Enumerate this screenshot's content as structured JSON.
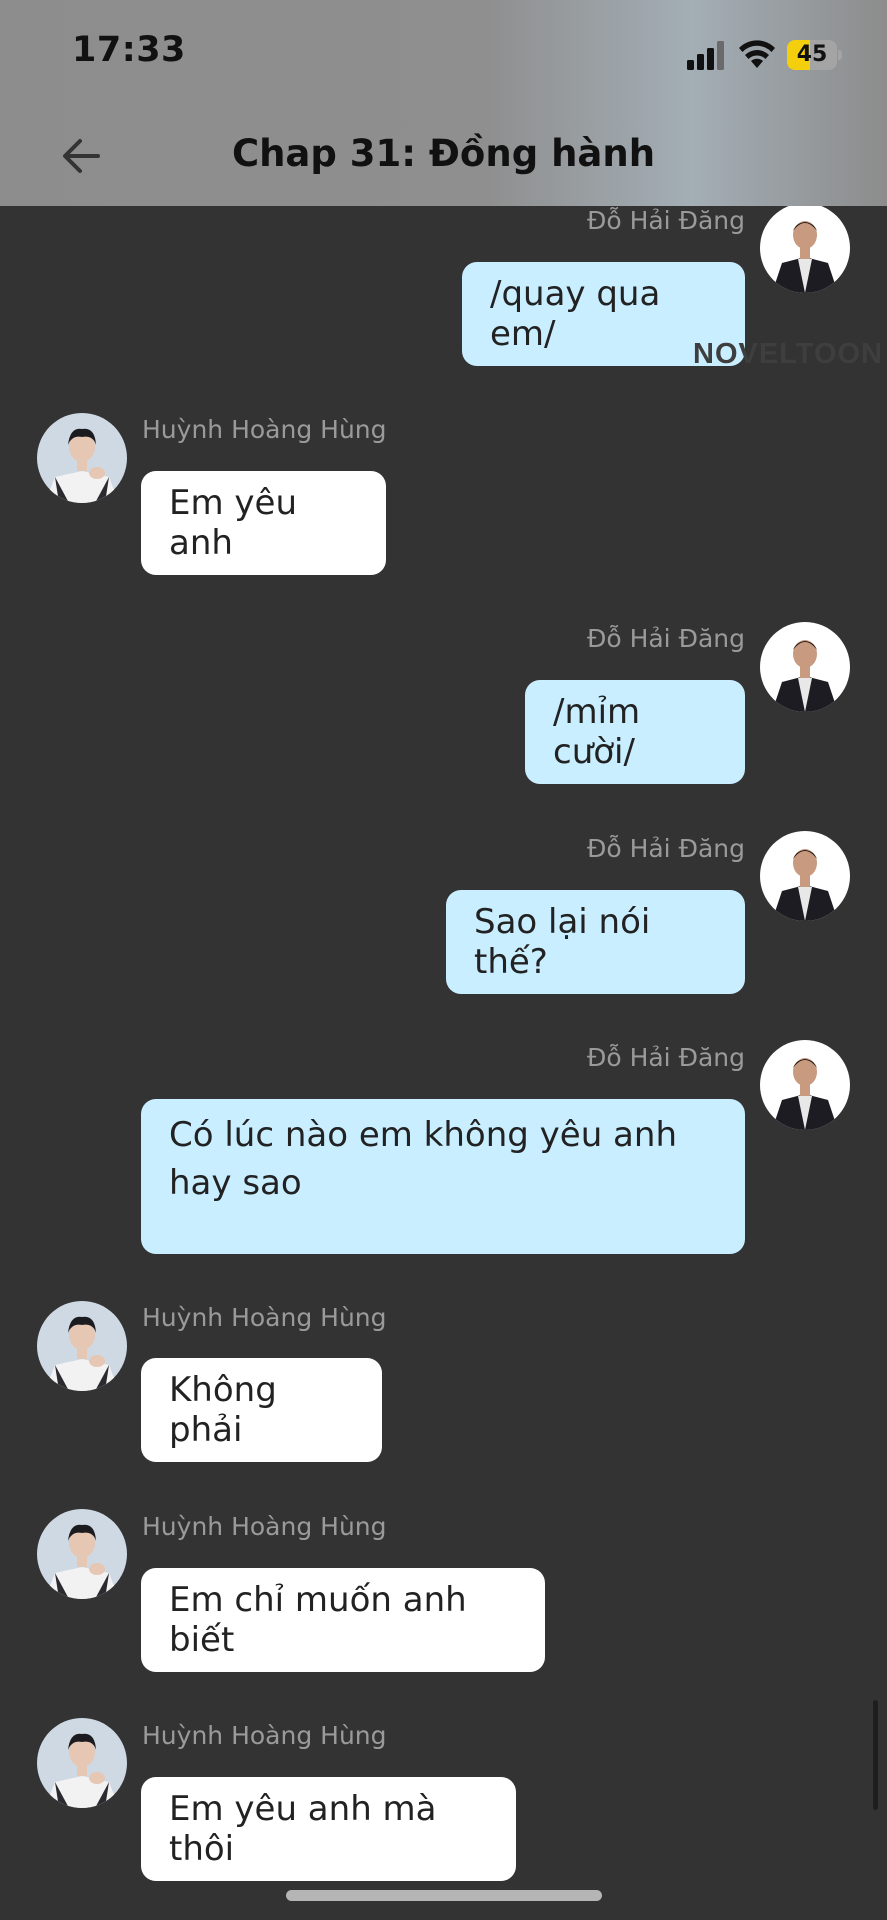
{
  "status_bar": {
    "time": "17:33",
    "battery": 45,
    "icons": [
      "signal-icon",
      "wifi-icon",
      "battery-icon"
    ]
  },
  "header": {
    "title": "Chap 31: Đồng hành",
    "back_icon": "arrow-left-icon"
  },
  "watermark": "NOVELTOON",
  "messages": [
    {
      "sender": "Đỗ Hải Đăng",
      "text": "/quay qua em/"
    },
    {
      "sender": "Huỳnh Hoàng Hùng",
      "text": "Em yêu anh"
    },
    {
      "sender": "Đỗ Hải Đăng",
      "text": "/mỉm cười/"
    },
    {
      "sender": "Đỗ Hải Đăng",
      "text": "Sao lại nói thế?"
    },
    {
      "sender": "Đỗ Hải Đăng",
      "lines": [
        "Có lúc nào em không yêu anh",
        "hay sao"
      ]
    },
    {
      "sender": "Huỳnh Hoàng Hùng",
      "text": "Không phải"
    },
    {
      "sender": "Huỳnh Hoàng Hùng",
      "text": "Em chỉ muốn anh biết"
    },
    {
      "sender": "Huỳnh Hoàng Hùng",
      "text": "Em yêu anh mà thôi"
    }
  ],
  "colors": {
    "background": "#333333",
    "my_bubble": "#c8eeff",
    "other_bubble": "#ffffff",
    "sender_name": "#9a9a9a",
    "battery_fill": "#f4cf0d"
  }
}
